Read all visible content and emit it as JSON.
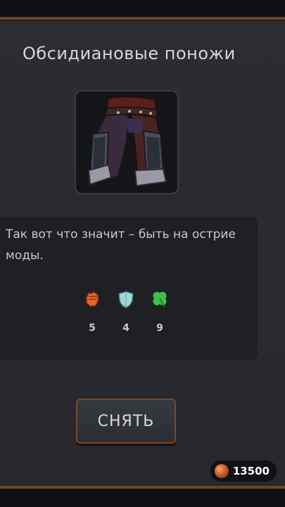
{
  "item": {
    "title": "Обсидиановые поножи",
    "icon": "obsidian-greaves-icon",
    "description": "Так вот что значит – быть на острие моды."
  },
  "stats": [
    {
      "icon": "fist-icon",
      "color": "#e8652a",
      "value": "5"
    },
    {
      "icon": "shield-icon",
      "color": "#9fd8d6",
      "value": "4"
    },
    {
      "icon": "clover-icon",
      "color": "#3fbf4a",
      "value": "9"
    }
  ],
  "actions": {
    "unequip_label": "СНЯТЬ"
  },
  "currency": {
    "icon": "copper-coin-icon",
    "amount": "13500"
  }
}
